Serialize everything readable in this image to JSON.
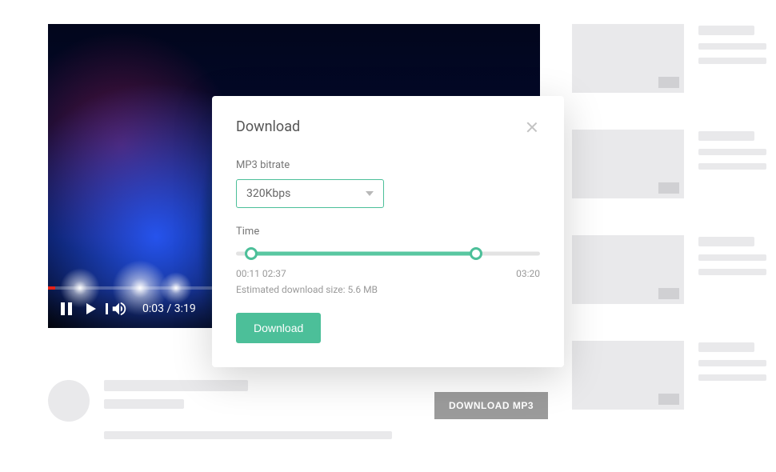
{
  "video": {
    "current_time": "0:03",
    "duration": "3:19",
    "progress_percent": 1.5
  },
  "download_mp3_button": "DOWNLOAD MP3",
  "modal": {
    "title": "Download",
    "bitrate_label": "MP3 bitrate",
    "bitrate_value": "320Kbps",
    "time_label": "Time",
    "range": {
      "start": "00:11",
      "end": "02:37",
      "total": "03:20",
      "start_percent": 5,
      "end_percent": 79
    },
    "estimate_text": "Estimated download size: 5.6 MB",
    "download_button": "Download"
  },
  "colors": {
    "accent": "#4cbf99",
    "video_progress": "#e62117",
    "placeholder": "#e9e9eb"
  }
}
